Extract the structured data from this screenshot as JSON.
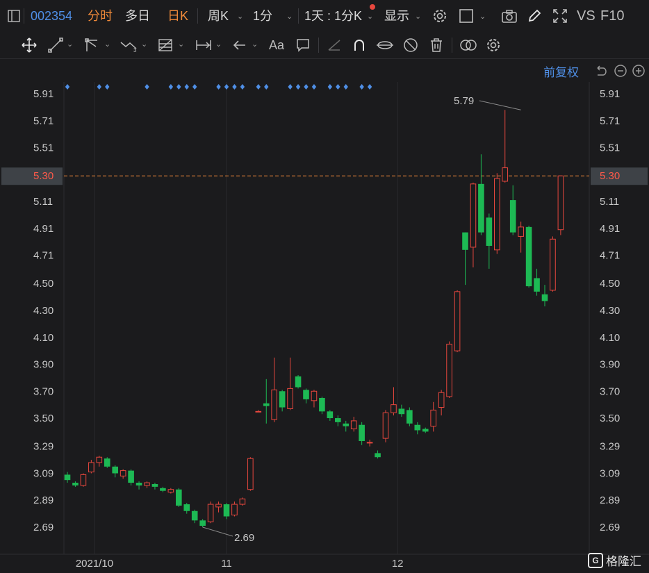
{
  "toolbar": {
    "code": "002354",
    "tabs": [
      "分时",
      "多日",
      "日K"
    ],
    "active_tab": "日K",
    "period_week": "周K",
    "period_min": "1分",
    "range": "1天 : 1分K",
    "display": "显示",
    "vs": "VS",
    "f10": "F10"
  },
  "adjust_label": "前复权",
  "watermark": "格隆汇",
  "colors": {
    "up": "#e8473e",
    "down": "#1db954",
    "accent": "#4f8fe6",
    "orange": "#f08a3a",
    "bg": "#1b1b1d",
    "grid": "#2e2e31"
  },
  "chart_data": {
    "type": "candlestick",
    "y_ticks": [
      "5.91",
      "5.71",
      "5.51",
      "5.30",
      "5.11",
      "4.91",
      "4.71",
      "4.50",
      "4.30",
      "4.10",
      "3.90",
      "3.70",
      "3.50",
      "3.29",
      "3.09",
      "2.89",
      "2.69"
    ],
    "ylim": [
      2.6,
      5.98
    ],
    "x_labels": [
      {
        "label": "2021/10",
        "index": 3.4
      },
      {
        "label": "11",
        "index": 20
      },
      {
        "label": "12",
        "index": 41.5
      }
    ],
    "current_price": 5.3,
    "current_price_label": "5.30",
    "max_label": "5.79",
    "min_label": "2.69",
    "max_value": 5.79,
    "min_value": 2.69,
    "max_index": 57,
    "min_index": 17,
    "candles": [
      [
        3.08,
        3.04,
        3.1,
        3.02
      ],
      [
        3.02,
        3.0,
        3.03,
        2.99
      ],
      [
        3.0,
        3.08,
        3.09,
        2.99
      ],
      [
        3.1,
        3.17,
        3.19,
        3.09
      ],
      [
        3.17,
        3.21,
        3.22,
        3.14
      ],
      [
        3.2,
        3.14,
        3.21,
        3.13
      ],
      [
        3.14,
        3.09,
        3.15,
        3.06
      ],
      [
        3.07,
        3.11,
        3.12,
        3.05
      ],
      [
        3.11,
        3.02,
        3.12,
        3.0
      ],
      [
        3.02,
        3.0,
        3.03,
        2.97
      ],
      [
        3.0,
        3.02,
        3.03,
        2.98
      ],
      [
        3.01,
        2.99,
        3.02,
        2.97
      ],
      [
        2.98,
        2.96,
        2.99,
        2.95
      ],
      [
        2.95,
        2.97,
        2.98,
        2.94
      ],
      [
        2.97,
        2.85,
        2.98,
        2.84
      ],
      [
        2.86,
        2.81,
        2.87,
        2.79
      ],
      [
        2.81,
        2.74,
        2.82,
        2.72
      ],
      [
        2.74,
        2.7,
        2.75,
        2.69
      ],
      [
        2.73,
        2.86,
        2.88,
        2.72
      ],
      [
        2.84,
        2.86,
        2.88,
        2.8
      ],
      [
        2.86,
        2.77,
        2.87,
        2.75
      ],
      [
        2.78,
        2.86,
        2.88,
        2.77
      ],
      [
        2.86,
        2.9,
        2.91,
        2.85
      ],
      [
        2.97,
        3.2,
        3.21,
        2.96
      ],
      [
        3.55,
        3.55,
        3.56,
        3.55
      ],
      [
        3.61,
        3.59,
        3.79,
        3.46
      ],
      [
        3.49,
        3.71,
        3.95,
        3.47
      ],
      [
        3.7,
        3.58,
        3.71,
        3.55
      ],
      [
        3.57,
        3.72,
        3.95,
        3.56
      ],
      [
        3.81,
        3.73,
        3.82,
        3.72
      ],
      [
        3.71,
        3.64,
        3.72,
        3.61
      ],
      [
        3.63,
        3.7,
        3.71,
        3.58
      ],
      [
        3.65,
        3.55,
        3.66,
        3.53
      ],
      [
        3.55,
        3.5,
        3.56,
        3.48
      ],
      [
        3.5,
        3.47,
        3.52,
        3.44
      ],
      [
        3.46,
        3.44,
        3.48,
        3.4
      ],
      [
        3.42,
        3.48,
        3.51,
        3.4
      ],
      [
        3.45,
        3.33,
        3.47,
        3.3
      ],
      [
        3.32,
        3.32,
        3.34,
        3.29
      ],
      [
        3.24,
        3.21,
        3.26,
        3.2
      ],
      [
        3.35,
        3.54,
        3.56,
        3.32
      ],
      [
        3.54,
        3.6,
        3.73,
        3.52
      ],
      [
        3.57,
        3.53,
        3.6,
        3.51
      ],
      [
        3.56,
        3.46,
        3.58,
        3.44
      ],
      [
        3.45,
        3.41,
        3.47,
        3.38
      ],
      [
        3.42,
        3.4,
        3.43,
        3.39
      ],
      [
        3.44,
        3.56,
        3.62,
        3.4
      ],
      [
        3.58,
        3.69,
        3.71,
        3.52
      ],
      [
        3.66,
        4.05,
        4.07,
        3.65
      ],
      [
        4.0,
        4.44,
        4.45,
        3.99
      ],
      [
        4.88,
        4.75,
        4.88,
        4.49
      ],
      [
        4.77,
        5.24,
        5.25,
        4.62
      ],
      [
        5.24,
        4.88,
        5.46,
        4.86
      ],
      [
        4.99,
        4.78,
        5.02,
        4.61
      ],
      [
        4.75,
        5.28,
        5.32,
        4.72
      ],
      [
        5.26,
        5.36,
        5.79,
        5.25
      ],
      [
        5.12,
        4.88,
        5.23,
        4.86
      ],
      [
        4.85,
        4.92,
        4.96,
        4.73
      ],
      [
        4.92,
        4.48,
        4.93,
        4.47
      ],
      [
        4.54,
        4.44,
        4.61,
        4.41
      ],
      [
        4.42,
        4.37,
        4.49,
        4.33
      ],
      [
        4.45,
        4.83,
        4.85,
        4.44
      ],
      [
        4.9,
        5.3,
        5.3,
        4.86
      ]
    ],
    "markers": [
      0,
      4,
      5,
      10,
      13,
      14,
      15,
      16,
      19,
      20,
      21,
      22,
      24,
      25,
      28,
      29,
      30,
      31,
      33,
      34,
      35,
      37,
      38
    ]
  }
}
